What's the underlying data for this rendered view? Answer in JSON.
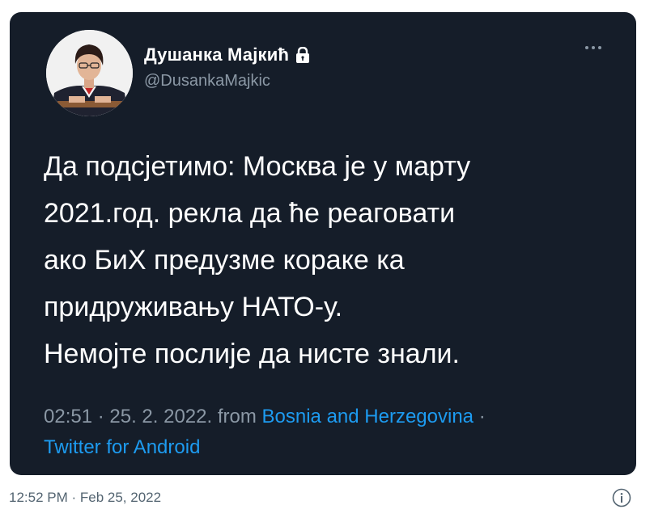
{
  "tweet": {
    "author_name": "Душанка Мајкић",
    "author_handle": "@DusankaMajkic",
    "lock_icon": "lock-icon",
    "more_icon": "more-horizontal-icon",
    "text_lines": [
      "Да подсјетимо: Москва је у марту",
      "2021.год. рекла да ће реаговати",
      "ако БиХ предузме кораке ка",
      "придруживању НАТО-у.",
      "Немојте послије да нисте знали."
    ],
    "time_date": "02:51 · 25. 2. 2022.",
    "from_label": "from",
    "location": "Bosnia and Herzegovina",
    "separator": "·",
    "source": "Twitter for Android"
  },
  "footer": {
    "timestamp": "12:52 PM · Feb 25, 2022",
    "info_icon": "info-icon"
  },
  "colors": {
    "card_background": "#151d29",
    "text_primary": "#ffffff",
    "text_secondary": "#8b98a5",
    "link": "#1d9bf0"
  }
}
